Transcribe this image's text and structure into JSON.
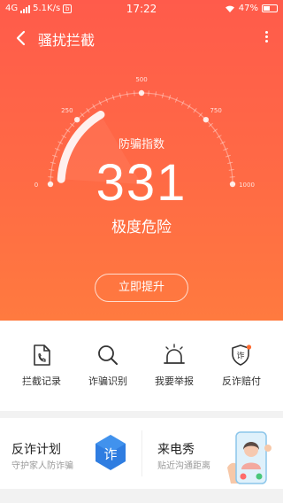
{
  "statusbar": {
    "network": "4G",
    "speed": "5.1K/s",
    "time": "17:22",
    "battery": "47%"
  },
  "header": {
    "title": "骚扰拦截"
  },
  "gauge": {
    "ticks": [
      "0",
      "250",
      "500",
      "750",
      "1000"
    ],
    "label": "防骗指数",
    "score": "331",
    "level": "极度危险",
    "score_value": 331,
    "score_max": 1000
  },
  "improve_button": "立即提升",
  "tools": [
    {
      "label": "拦截记录",
      "icon": "call-log-icon"
    },
    {
      "label": "诈骗识别",
      "icon": "search-icon"
    },
    {
      "label": "我要举报",
      "icon": "siren-icon"
    },
    {
      "label": "反诈赔付",
      "icon": "fraud-shield-icon"
    }
  ],
  "cards": [
    {
      "title": "反诈计划",
      "subtitle": "守护家人防诈骗",
      "icon": "fraud-badge-icon",
      "badge_text": "诈"
    },
    {
      "title": "来电秀",
      "subtitle": "贴近沟通距离",
      "icon": "phone-caller-illustration"
    }
  ],
  "colors": {
    "hero_top": "#ff5b4b",
    "hero_bottom": "#ff7a3f",
    "accent_blue": "#2f7de1"
  }
}
